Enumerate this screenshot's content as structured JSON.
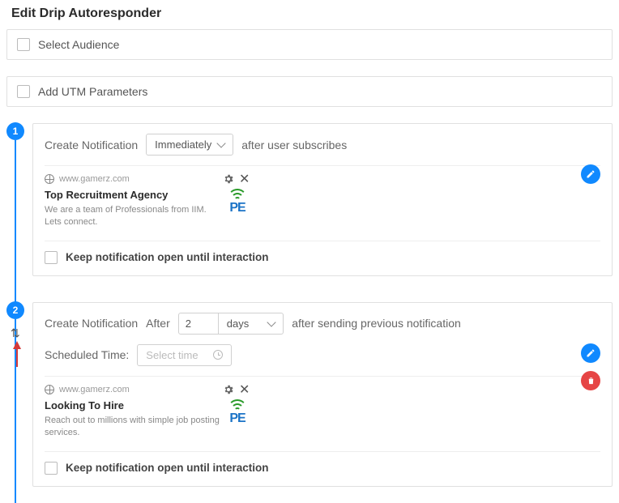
{
  "title": "Edit Drip Autoresponder",
  "selectAudience": {
    "label": "Select Audience"
  },
  "utm": {
    "label": "Add UTM Parameters"
  },
  "steps": [
    {
      "num": "1",
      "createLabel": "Create Notification",
      "timingSelect": "Immediately",
      "afterText": "after user subscribes",
      "domain": "www.gamerz.com",
      "previewTitle": "Top Recruitment Agency",
      "previewBody": "We are a team of  Professionals from IIM. Lets connect.",
      "keepOpen": "Keep notification open until interaction"
    },
    {
      "num": "2",
      "createLabel": "Create Notification",
      "afterWord": "After",
      "delayValue": "2",
      "delayUnit": "days",
      "afterText": "after sending previous notification",
      "schedLabel": "Scheduled Time:",
      "schedPlaceholder": "Select time",
      "domain": "www.gamerz.com",
      "previewTitle": "Looking To Hire",
      "previewBody": "Reach out to millions with simple job posting services.",
      "keepOpen": "Keep notification open until interaction"
    }
  ]
}
